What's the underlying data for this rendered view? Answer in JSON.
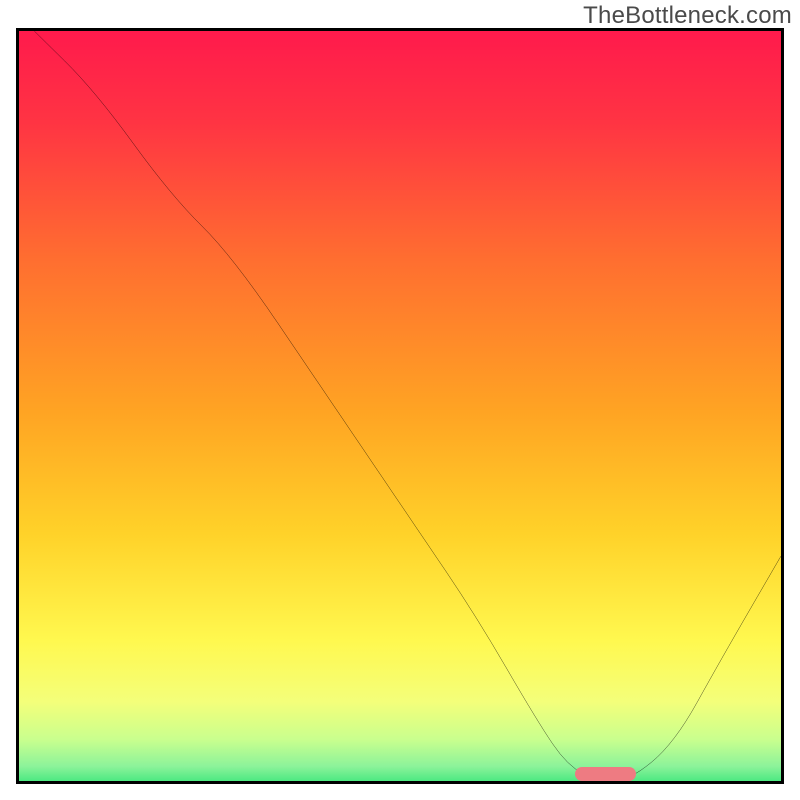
{
  "watermark": "TheBottleneck.com",
  "colors": {
    "border": "#000000",
    "curve": "#000000",
    "marker": "#ee7b82",
    "gradient_stops": [
      {
        "offset": 0.0,
        "color": "#ff1a4c"
      },
      {
        "offset": 0.12,
        "color": "#ff3443"
      },
      {
        "offset": 0.3,
        "color": "#ff6e30"
      },
      {
        "offset": 0.5,
        "color": "#ffa423"
      },
      {
        "offset": 0.66,
        "color": "#ffd229"
      },
      {
        "offset": 0.8,
        "color": "#fff84f"
      },
      {
        "offset": 0.88,
        "color": "#f4ff7a"
      },
      {
        "offset": 0.93,
        "color": "#c9ff8e"
      },
      {
        "offset": 0.965,
        "color": "#8cf39a"
      },
      {
        "offset": 1.0,
        "color": "#19e06e"
      }
    ]
  },
  "chart_data": {
    "type": "line",
    "title": "",
    "xlabel": "",
    "ylabel": "",
    "xlim": [
      0,
      100
    ],
    "ylim": [
      0,
      100
    ],
    "x": [
      2,
      10,
      20,
      28,
      40,
      52,
      60,
      68,
      72,
      76,
      80,
      86,
      92,
      100
    ],
    "values": [
      100,
      92,
      78,
      70,
      52,
      34,
      22,
      8,
      2,
      0,
      0,
      5,
      16,
      30
    ],
    "marker": {
      "x_start": 73,
      "x_end": 81,
      "y": 0
    },
    "note": "V-shaped bottleneck curve over a vertical red-to-green heat gradient; minimum (zero) around x≈73–81 with a small pink bar at the baseline; values are read-off estimates since axes are unlabeled."
  }
}
